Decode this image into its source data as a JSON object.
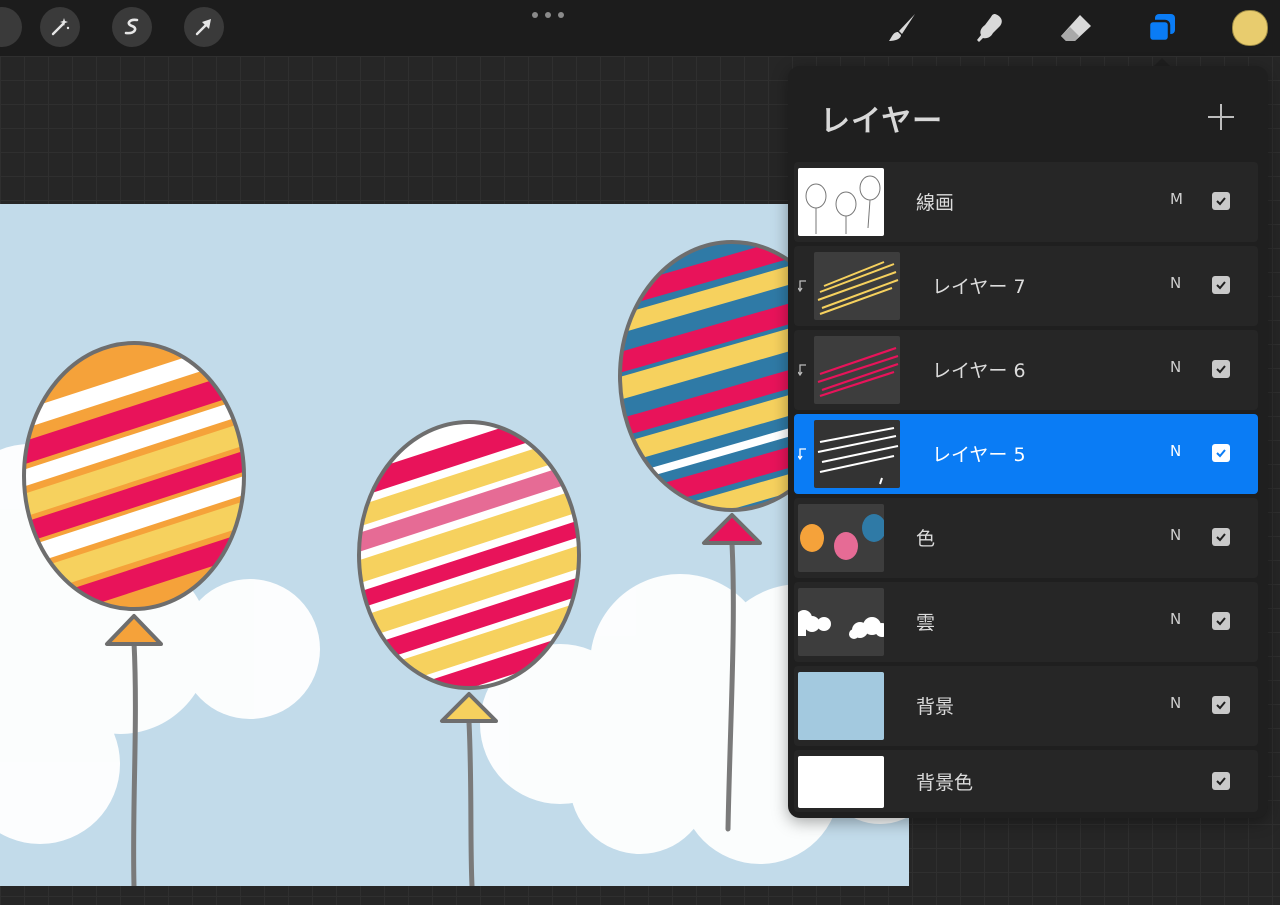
{
  "toolbar": {
    "left_tools": [
      "magic-wand-icon",
      "selection-s-icon",
      "transform-arrow-icon"
    ],
    "right_tools": [
      "brush-icon",
      "smudge-icon",
      "eraser-icon",
      "layers-icon"
    ],
    "current_color": "#e8cc6e",
    "accent": "#0a7cf5"
  },
  "layers_panel": {
    "title": "レイヤー",
    "layers": [
      {
        "name": "線画",
        "mode": "M",
        "visible": true,
        "clipped": false,
        "selected": false
      },
      {
        "name": "レイヤー 7",
        "mode": "N",
        "visible": true,
        "clipped": true,
        "selected": false
      },
      {
        "name": "レイヤー 6",
        "mode": "N",
        "visible": true,
        "clipped": true,
        "selected": false
      },
      {
        "name": "レイヤー 5",
        "mode": "N",
        "visible": true,
        "clipped": true,
        "selected": true
      },
      {
        "name": "色",
        "mode": "N",
        "visible": true,
        "clipped": false,
        "selected": false
      },
      {
        "name": "雲",
        "mode": "N",
        "visible": true,
        "clipped": false,
        "selected": false
      },
      {
        "name": "背景",
        "mode": "N",
        "visible": true,
        "clipped": false,
        "selected": false
      },
      {
        "name": "背景色",
        "mode": "",
        "visible": true,
        "clipped": false,
        "selected": false
      }
    ]
  }
}
